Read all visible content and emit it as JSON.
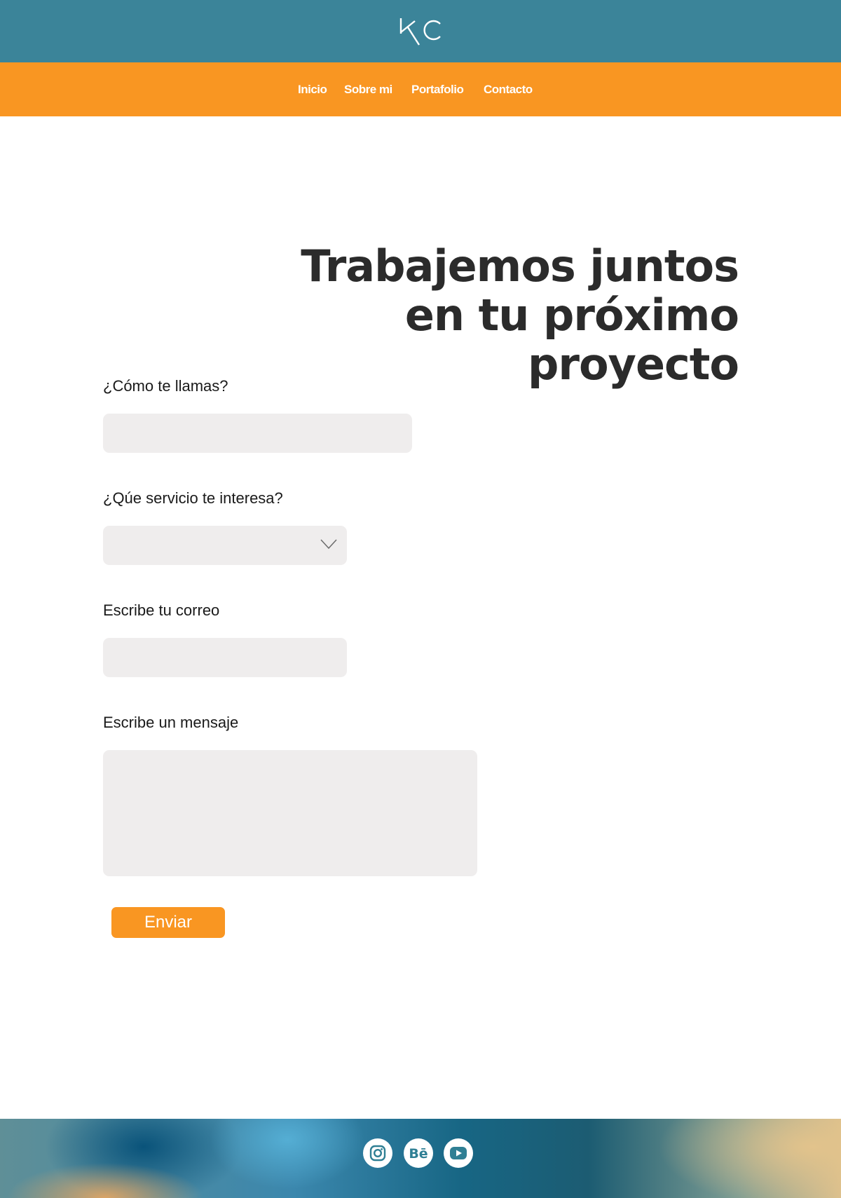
{
  "header": {
    "logo_text": "KC",
    "nav": [
      {
        "label": "Inicio"
      },
      {
        "label": "Sobre mi"
      },
      {
        "label": "Portafolio"
      },
      {
        "label": "Contacto"
      }
    ]
  },
  "hero": {
    "title_line1": "Trabajemos juntos",
    "title_line2": "en tu próximo",
    "title_line3": "proyecto"
  },
  "form": {
    "name_label": "¿Cómo te llamas?",
    "service_label": "¿Qúe servicio te interesa?",
    "email_label": "Escribe tu correo",
    "message_label": "Escribe un mensaje",
    "submit_label": "Enviar"
  },
  "footer": {
    "social": [
      {
        "icon": "instagram-icon"
      },
      {
        "icon": "behance-icon",
        "text": "Bē"
      },
      {
        "icon": "youtube-icon"
      }
    ]
  },
  "colors": {
    "header_bg": "#3b8499",
    "nav_bg": "#f99622",
    "input_bg": "#efeded",
    "button_bg": "#f99622",
    "icon_color": "#2f7f94"
  }
}
